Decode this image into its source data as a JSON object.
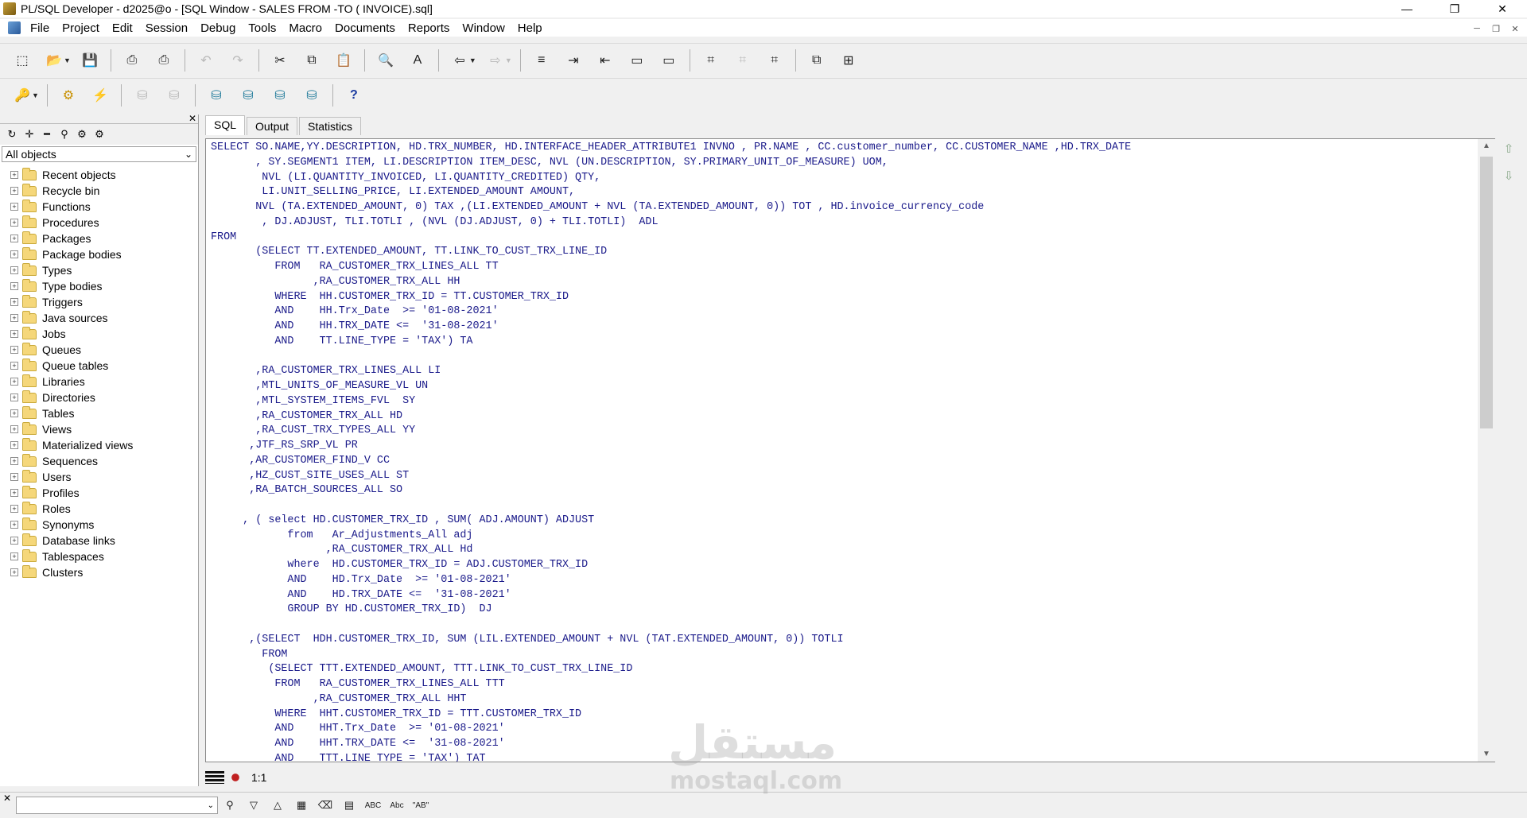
{
  "window": {
    "title": "PL/SQL Developer - d2025@o - [SQL Window - SALES FROM -TO ( INVOICE).sql]",
    "minimize": "—",
    "maximize": "❐",
    "close": "✕"
  },
  "menu": [
    "File",
    "Project",
    "Edit",
    "Session",
    "Debug",
    "Tools",
    "Macro",
    "Documents",
    "Reports",
    "Window",
    "Help"
  ],
  "object_browser": {
    "filter": "All objects",
    "items": [
      "Recent objects",
      "Recycle bin",
      "Functions",
      "Procedures",
      "Packages",
      "Package bodies",
      "Types",
      "Type bodies",
      "Triggers",
      "Java sources",
      "Jobs",
      "Queues",
      "Queue tables",
      "Libraries",
      "Directories",
      "Tables",
      "Views",
      "Materialized views",
      "Sequences",
      "Users",
      "Profiles",
      "Roles",
      "Synonyms",
      "Database links",
      "Tablespaces",
      "Clusters"
    ]
  },
  "tabs": [
    "SQL",
    "Output",
    "Statistics"
  ],
  "editor": {
    "code": "SELECT SO.NAME,YY.DESCRIPTION, HD.TRX_NUMBER, HD.INTERFACE_HEADER_ATTRIBUTE1 INVNO , PR.NAME , CC.customer_number, CC.CUSTOMER_NAME ,HD.TRX_DATE\n       , SY.SEGMENT1 ITEM, LI.DESCRIPTION ITEM_DESC, NVL (UN.DESCRIPTION, SY.PRIMARY_UNIT_OF_MEASURE) UOM,\n        NVL (LI.QUANTITY_INVOICED, LI.QUANTITY_CREDITED) QTY,\n        LI.UNIT_SELLING_PRICE, LI.EXTENDED_AMOUNT AMOUNT,\n       NVL (TA.EXTENDED_AMOUNT, 0) TAX ,(LI.EXTENDED_AMOUNT + NVL (TA.EXTENDED_AMOUNT, 0)) TOT , HD.invoice_currency_code\n        , DJ.ADJUST, TLI.TOTLI , (NVL (DJ.ADJUST, 0) + TLI.TOTLI)  ADL\nFROM\n       (SELECT TT.EXTENDED_AMOUNT, TT.LINK_TO_CUST_TRX_LINE_ID\n          FROM   RA_CUSTOMER_TRX_LINES_ALL TT\n                ,RA_CUSTOMER_TRX_ALL HH\n          WHERE  HH.CUSTOMER_TRX_ID = TT.CUSTOMER_TRX_ID\n          AND    HH.Trx_Date  >= '01-08-2021'\n          AND    HH.TRX_DATE <=  '31-08-2021'\n          AND    TT.LINE_TYPE = 'TAX') TA\n\n       ,RA_CUSTOMER_TRX_LINES_ALL LI\n       ,MTL_UNITS_OF_MEASURE_VL UN\n       ,MTL_SYSTEM_ITEMS_FVL  SY\n       ,RA_CUSTOMER_TRX_ALL HD\n       ,RA_CUST_TRX_TYPES_ALL YY\n      ,JTF_RS_SRP_VL PR\n      ,AR_CUSTOMER_FIND_V CC\n      ,HZ_CUST_SITE_USES_ALL ST\n      ,RA_BATCH_SOURCES_ALL SO\n\n     , ( select HD.CUSTOMER_TRX_ID , SUM( ADJ.AMOUNT) ADJUST\n            from   Ar_Adjustments_All adj\n                  ,RA_CUSTOMER_TRX_ALL Hd\n            where  HD.CUSTOMER_TRX_ID = ADJ.CUSTOMER_TRX_ID\n            AND    HD.Trx_Date  >= '01-08-2021'\n            AND    HD.TRX_DATE <=  '31-08-2021'\n            GROUP BY HD.CUSTOMER_TRX_ID)  DJ\n\n      ,(SELECT  HDH.CUSTOMER_TRX_ID, SUM (LIL.EXTENDED_AMOUNT + NVL (TAT.EXTENDED_AMOUNT, 0)) TOTLI\n        FROM\n         (SELECT TTT.EXTENDED_AMOUNT, TTT.LINK_TO_CUST_TRX_LINE_ID\n          FROM   RA_CUSTOMER_TRX_LINES_ALL TTT\n                ,RA_CUSTOMER_TRX_ALL HHT\n          WHERE  HHT.CUSTOMER_TRX_ID = TTT.CUSTOMER_TRX_ID\n          AND    HHT.Trx_Date  >= '01-08-2021'\n          AND    HHT.TRX_DATE <=  '31-08-2021'\n          AND    TTT.LINE_TYPE = 'TAX') TAT"
  },
  "status": {
    "position": "1:1"
  },
  "watermark": {
    "arabic": "مستقل",
    "latin": "mostaql.com"
  }
}
